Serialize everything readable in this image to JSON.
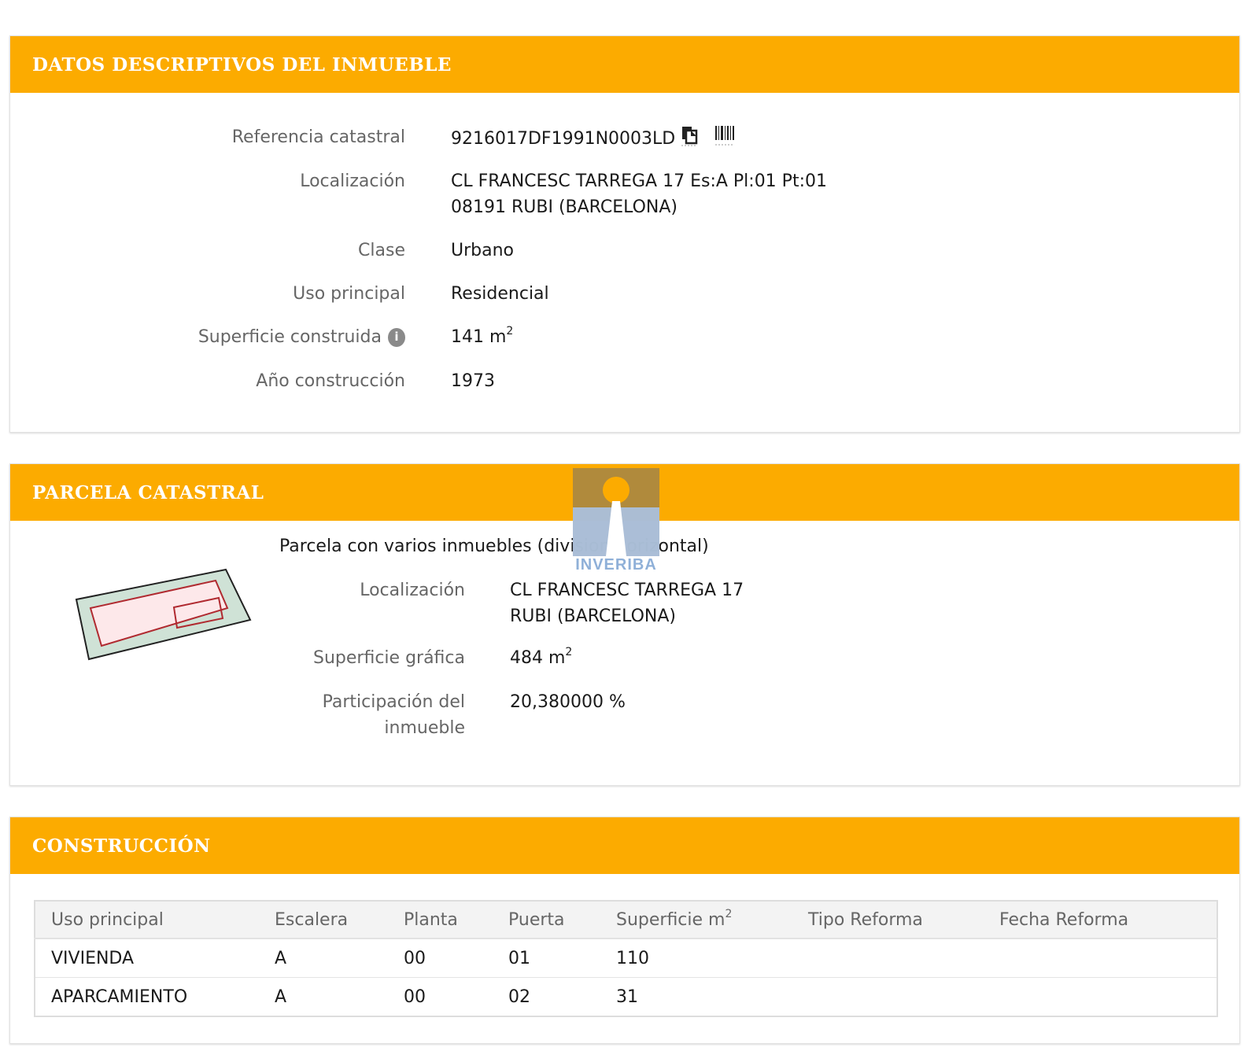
{
  "datos": {
    "header": "DATOS DESCRIPTIVOS DEL INMUEBLE",
    "referencia_label": "Referencia catastral",
    "referencia_value": "9216017DF1991N0003LD",
    "localizacion_label": "Localización",
    "localizacion_line1": "CL FRANCESC TARREGA 17 Es:A Pl:01 Pt:01",
    "localizacion_line2": "08191 RUBI (BARCELONA)",
    "clase_label": "Clase",
    "clase_value": "Urbano",
    "uso_label": "Uso principal",
    "uso_value": "Residencial",
    "superficie_label": "Superficie construida",
    "superficie_value": "141 m",
    "superficie_sup": "2",
    "anio_label": "Año construcción",
    "anio_value": "1973"
  },
  "parcela": {
    "header": "PARCELA CATASTRAL",
    "subtitle": "Parcela con varios inmuebles (division horizontal)",
    "localizacion_label": "Localización",
    "localizacion_line1": "CL FRANCESC TARREGA 17",
    "localizacion_line2": "RUBI (BARCELONA)",
    "superficie_label": "Superficie gráfica",
    "superficie_value": "484 m",
    "superficie_sup": "2",
    "participacion_label_line1": "Participación del",
    "participacion_label_line2": "inmueble",
    "participacion_value": "20,380000 %"
  },
  "construccion": {
    "header": "CONSTRUCCIÓN",
    "columns": [
      "Uso principal",
      "Escalera",
      "Planta",
      "Puerta",
      "Superficie m",
      "Tipo Reforma",
      "Fecha Reforma"
    ],
    "superficie_col_sup": "2",
    "rows": [
      [
        "VIVIENDA",
        "A",
        "00",
        "01",
        "110",
        "",
        ""
      ],
      [
        "APARCAMIENTO",
        "A",
        "00",
        "02",
        "31",
        "",
        ""
      ]
    ]
  },
  "watermark": {
    "text": "INVERIBA",
    "color": "#8fb0d8"
  },
  "colors": {
    "header_bg": "#fcab00",
    "label_text": "#666666"
  }
}
